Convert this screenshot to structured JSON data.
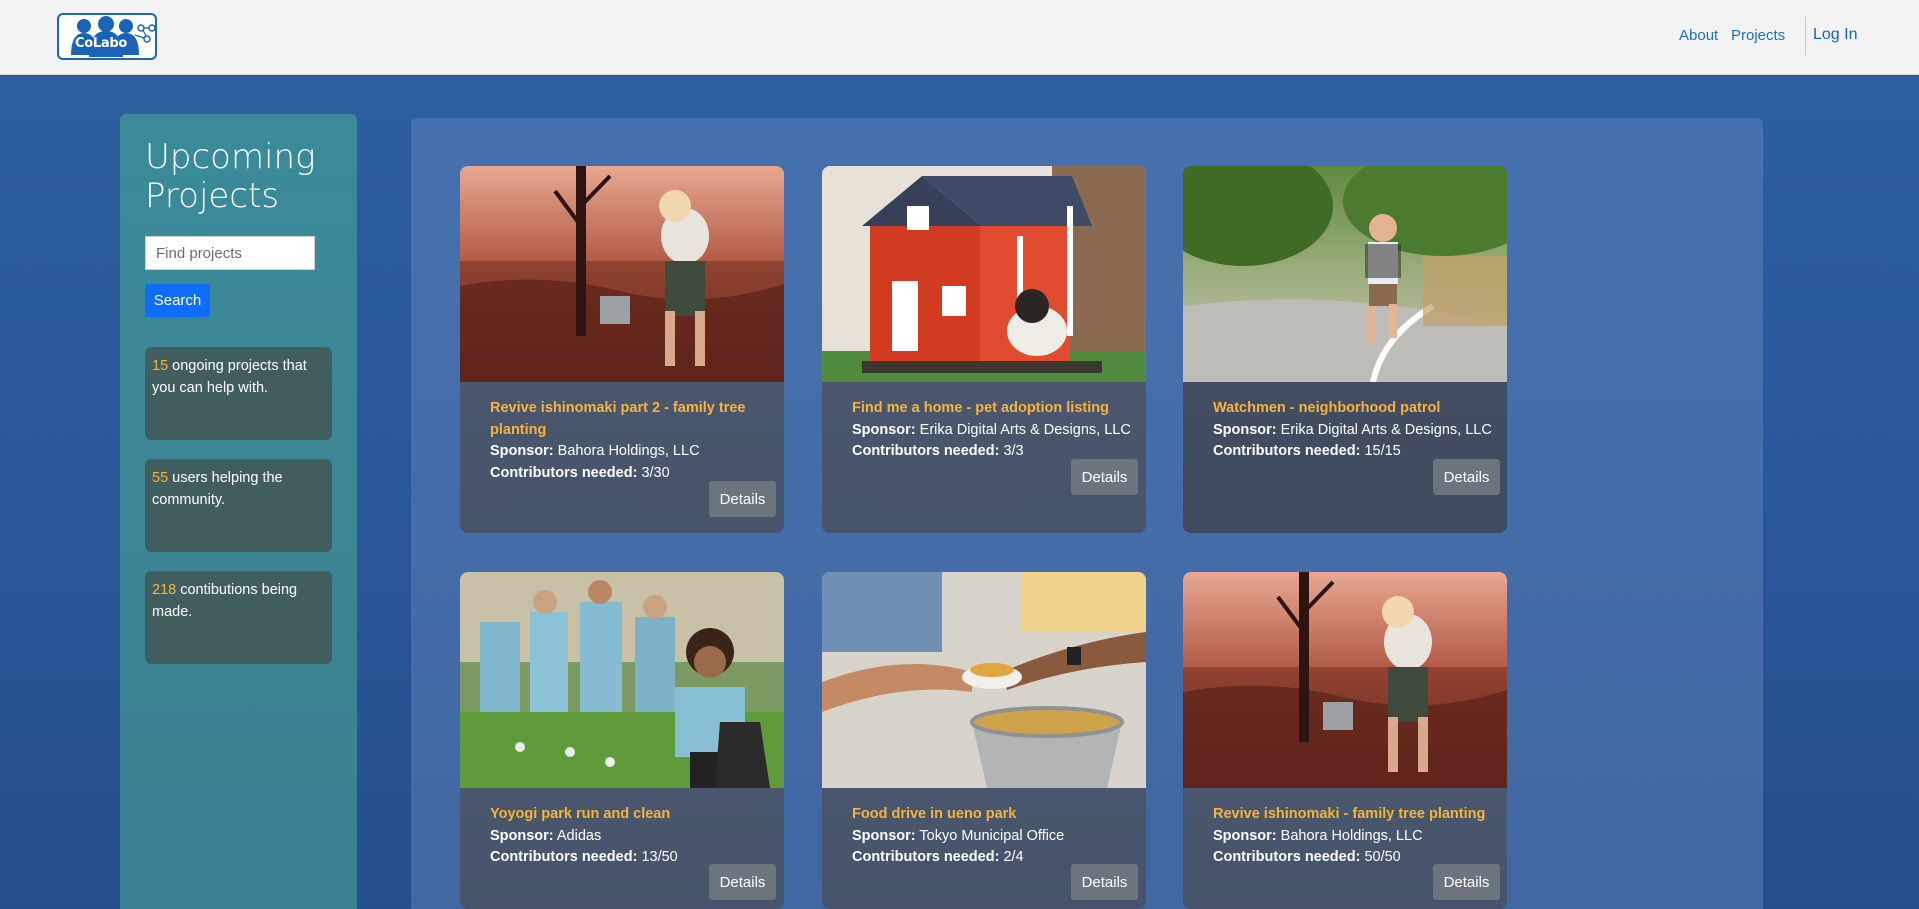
{
  "header": {
    "logo_text": "CoLabo",
    "nav": {
      "about": "About",
      "projects": "Projects",
      "login": "Log In"
    }
  },
  "sidebar": {
    "title": "Upcoming Projects",
    "search": {
      "placeholder": "Find projects",
      "button": "Search"
    },
    "stats": [
      {
        "number": "15",
        "text": " ongoing projects that you can help with."
      },
      {
        "number": "55",
        "text": " users helping the community."
      },
      {
        "number": "218",
        "text": " contibutions being made."
      }
    ]
  },
  "labels": {
    "sponsor": "Sponsor:",
    "contributors": "Contributors needed:",
    "details": "Details"
  },
  "projects": [
    {
      "title": "Revive ishinomaki part 2 - family tree planting",
      "sponsor": "Bahora Holdings, LLC",
      "contributors": "3/30",
      "image": "child-watering-tree-photo"
    },
    {
      "title": "Find me a home - pet adoption listing",
      "sponsor": "Erika Digital Arts & Designs, LLC",
      "contributors": "3/3",
      "image": "dog-house-photo"
    },
    {
      "title": "Watchmen - neighborhood patrol",
      "sponsor": "Erika Digital Arts & Designs, LLC",
      "contributors": "15/15",
      "image": "child-running-road-photo"
    },
    {
      "title": "Yoyogi park run and clean",
      "sponsor": "Adidas",
      "contributors": "13/50",
      "image": "volunteers-cleaning-park-photo"
    },
    {
      "title": "Food drive in ueno park",
      "sponsor": "Tokyo Municipal Office",
      "contributors": "2/4",
      "image": "food-serving-photo"
    },
    {
      "title": "Revive ishinomaki - family tree planting",
      "sponsor": "Bahora Holdings, LLC",
      "contributors": "50/50",
      "image": "child-watering-tree-photo"
    }
  ],
  "colors": {
    "accent": "#f5b33b",
    "primary_button": "#0d6efd",
    "secondary_button": "#6c757d",
    "link": "#1d6fc0"
  }
}
